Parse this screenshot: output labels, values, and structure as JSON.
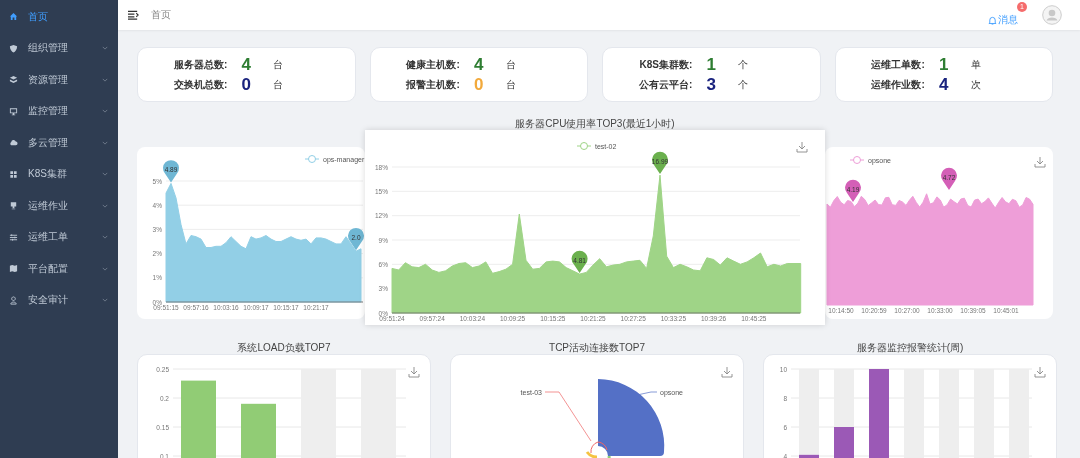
{
  "sidebar": {
    "items": [
      {
        "label": "首页",
        "selected": true
      },
      {
        "label": "组织管理",
        "selected": false
      },
      {
        "label": "资源管理",
        "selected": false
      },
      {
        "label": "监控管理",
        "selected": false
      },
      {
        "label": "多云管理",
        "selected": false
      },
      {
        "label": "K8S集群",
        "selected": false
      },
      {
        "label": "运维作业",
        "selected": false
      },
      {
        "label": "运维工单",
        "selected": false
      },
      {
        "label": "平台配置",
        "selected": false
      },
      {
        "label": "安全审计",
        "selected": false
      }
    ]
  },
  "topbar": {
    "breadcrumb": "首页",
    "messages": {
      "label": "消息",
      "badge": "1"
    }
  },
  "stats": [
    {
      "rows": [
        {
          "label": "服务器总数:",
          "value": "4",
          "unit": "台",
          "color": "#2e7d32"
        },
        {
          "label": "交换机总数:",
          "value": "0",
          "unit": "台",
          "color": "#1a237e"
        }
      ]
    },
    {
      "rows": [
        {
          "label": "健康主机数:",
          "value": "4",
          "unit": "台",
          "color": "#2e7d32"
        },
        {
          "label": "报警主机数:",
          "value": "0",
          "unit": "台",
          "color": "#f2a93b"
        }
      ]
    },
    {
      "rows": [
        {
          "label": "K8S集群数:",
          "value": "1",
          "unit": "个",
          "color": "#2e7d32"
        },
        {
          "label": "公有云平台:",
          "value": "3",
          "unit": "个",
          "color": "#1a237e"
        }
      ]
    },
    {
      "rows": [
        {
          "label": "运维工单数:",
          "value": "1",
          "unit": "单",
          "color": "#2e7d32"
        },
        {
          "label": "运维作业数:",
          "value": "4",
          "unit": "次",
          "color": "#1a237e"
        }
      ]
    }
  ],
  "cpu_section": {
    "title": "服务器CPU使用率TOP3(最近1小时)",
    "charts": [
      {
        "kind": "chart",
        "pins": [
          "4.89",
          "2.0"
        ],
        "chart_data": {
          "type": "area",
          "grid": true,
          "categories": [
            "09:51:15",
            null,
            null,
            null,
            null,
            null,
            "09:57:16",
            null,
            null,
            null,
            null,
            null,
            "10:03:16",
            null,
            null,
            null,
            null,
            null,
            "10:09:17",
            null,
            null,
            null,
            null,
            null,
            "10:15:17",
            null,
            null,
            null,
            null,
            null,
            "10:21:17",
            null,
            null,
            null,
            null,
            null,
            null,
            null,
            null,
            null
          ],
          "series": [
            {
              "name": "ops-manager",
              "color": "#92cfe6",
              "values": [
                4.5,
                4.9,
                4.3,
                3.2,
                2.4,
                2.75,
                2.7,
                2.6,
                2.25,
                2.25,
                2.3,
                2.3,
                2.45,
                2.7,
                2.5,
                2.3,
                2.2,
                2.7,
                2.6,
                2.65,
                2.75,
                2.6,
                2.5,
                2.5,
                2.6,
                2.7,
                2.6,
                2.55,
                2.6,
                2.4,
                2.65,
                2.65,
                2.6,
                2.5,
                2.4,
                2.4,
                2.7,
                null,
                2.1,
                2.2
              ]
            }
          ],
          "ylim": [
            0,
            5
          ],
          "yticks": [
            {
              "value": 0,
              "label": "0%"
            },
            {
              "value": 1,
              "label": "1%"
            },
            {
              "value": 2,
              "label": "2%"
            },
            {
              "value": 3,
              "label": "3%"
            },
            {
              "value": 4,
              "label": "4%"
            },
            {
              "value": 5,
              "label": "5%"
            }
          ]
        }
      },
      {
        "kind": "chart",
        "pins": [
          "16.99",
          "4.81"
        ],
        "chart_data": {
          "type": "area",
          "grid": true,
          "categories": [
            "09:51:24",
            null,
            null,
            null,
            null,
            null,
            "09:57:24",
            null,
            null,
            null,
            null,
            null,
            "10:03:24",
            null,
            null,
            null,
            null,
            null,
            "10:09:25",
            null,
            null,
            null,
            null,
            null,
            "10:15:25",
            null,
            null,
            null,
            null,
            null,
            "10:21:25",
            null,
            null,
            null,
            null,
            null,
            "10:27:25",
            null,
            null,
            null,
            null,
            null,
            "10:33:25",
            null,
            null,
            null,
            null,
            null,
            "10:39:26",
            null,
            null,
            null,
            null,
            null,
            "10:45:25",
            null,
            null,
            null,
            null,
            null,
            null,
            null
          ],
          "series": [
            {
              "name": "test-02",
              "color": "#9fd487",
              "values": [
                5.5,
                5.3,
                6.2,
                5.7,
                5.6,
                6.0,
                5.3,
                5.0,
                5.2,
                5.8,
                6.1,
                6.2,
                5.6,
                5.8,
                6.3,
                4.9,
                5.1,
                5.4,
                6.0,
                12.2,
                6.5,
                5.4,
                5.5,
                6.3,
                6.4,
                6.3,
                5.6,
                5.2,
                4.8,
                5.0,
                5.9,
                6.7,
                5.7,
                5.9,
                6.0,
                6.3,
                6.4,
                6.5,
                5.5,
                9.5,
                17.0,
                7.0,
                5.6,
                6.0,
                5.7,
                5.3,
                5.2,
                6.8,
                6.6,
                5.9,
                6.8,
                6.4,
                6.0,
                6.3,
                6.8,
                7.4,
                5.7,
                6.0,
                5.8,
                6.1,
                6.1,
                6.1
              ]
            }
          ],
          "ylim": [
            0,
            18
          ],
          "yticks": [
            {
              "value": 0,
              "label": "0%"
            },
            {
              "value": 3,
              "label": "3%"
            },
            {
              "value": 6,
              "label": "6%"
            },
            {
              "value": 9,
              "label": "9%"
            },
            {
              "value": 12,
              "label": "12%"
            },
            {
              "value": 15,
              "label": "15%"
            },
            {
              "value": 18,
              "label": "18%"
            }
          ]
        }
      },
      {
        "kind": "drawing",
        "legend": "opsone",
        "color": "#ee9ed8",
        "pins": [
          "4.19",
          "4.72"
        ],
        "x_labels": [
          "10:14:50",
          "10:20:59",
          "10:27:00",
          "10:33:00",
          "10:39:05",
          "10:45:01"
        ]
      }
    ]
  },
  "bottom": [
    {
      "title": "系统LOAD负载TOP7",
      "kind": "bar",
      "chart_data": {
        "type": "bar",
        "grid": true,
        "stacked": true,
        "series": [
          {
            "color": "#91cc75",
            "values": [
              0.23,
              0.19,
              null,
              null
            ]
          },
          {
            "color": "#eeeeee",
            "values": [
              null,
              null,
              0.25,
              0.25
            ]
          }
        ],
        "ylim": [
          0.095,
          0.25
        ],
        "yticks": [
          {
            "value": 0.1,
            "label": "0.1"
          },
          {
            "value": 0.15,
            "label": "0.15"
          },
          {
            "value": 0.2,
            "label": "0.2"
          },
          {
            "value": 0.25,
            "label": "0.25"
          }
        ]
      }
    },
    {
      "title": "TCP活动连接数TOP7",
      "kind": "rose",
      "labels": [
        "test-03",
        "opsone"
      ]
    },
    {
      "title": "服务器监控报警统计(周)",
      "kind": "bar",
      "chart_data": {
        "type": "bar",
        "grid": true,
        "stacked": true,
        "series": [
          {
            "color": "#9b59b6",
            "values": [
              4.1,
              6,
              10,
              null,
              null,
              null,
              null
            ]
          },
          {
            "color": "#eeeeee",
            "values": [
              5.9,
              4,
              null,
              10,
              10,
              10,
              10
            ]
          }
        ],
        "ylim": [
          3.8,
          10
        ],
        "yticks": [
          {
            "value": 4,
            "label": "4"
          },
          {
            "value": 6,
            "label": "6"
          },
          {
            "value": 8,
            "label": "8"
          },
          {
            "value": 10,
            "label": "10"
          }
        ]
      }
    }
  ]
}
